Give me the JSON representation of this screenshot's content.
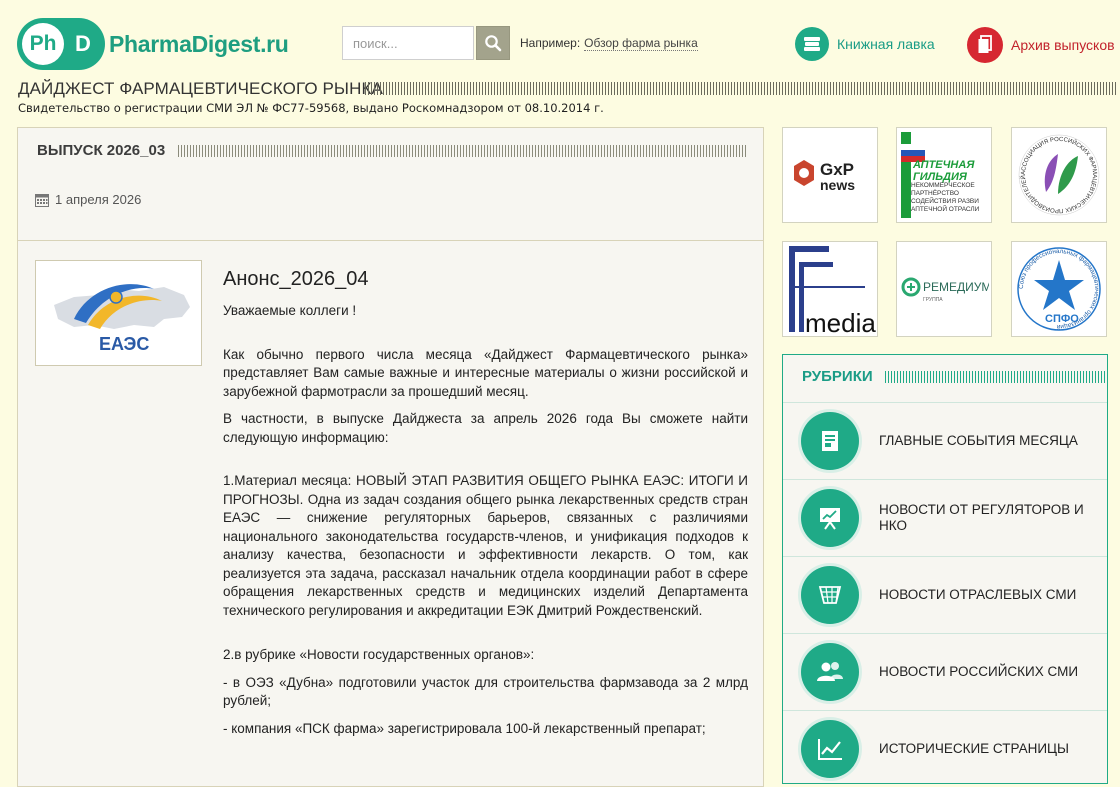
{
  "header": {
    "logo_badge_ph": "Ph",
    "logo_badge_d": "D",
    "logo_text": "PharmaDigest.ru",
    "search_placeholder": "поиск...",
    "example_label": "Например:",
    "example_link": "Обзор фарма рынка",
    "book_shop": "Книжная лавка",
    "archive": "Архив выпусков",
    "page_title": "ДАЙДЖЕСТ ФАРМАЦЕВТИЧЕСКОГО РЫНКА",
    "registration": "Свидетельство о регистрации СМИ ЭЛ № ФС77-59568, выдано Роскомнадзором от 08.10.2014 г."
  },
  "issue": {
    "title": "ВЫПУСК 2026_03",
    "date": "1 апреля 2026"
  },
  "post": {
    "thumb_caption": "ЕАЭС",
    "title": "Анонс_2026_04",
    "greeting": "Уважаемые коллеги !",
    "p1": "Как обычно первого числа месяца «Дайджест Фармацевтического рынка» представляет Вам самые важные и интересные материалы о жизни российской и зарубежной фармотрасли за прошедший месяц.",
    "p2": "В частности, в выпуске Дайджеста за апрель 2026 года Вы сможете найти следующую информацию:",
    "p3": "1.Материал месяца: НОВЫЙ ЭТАП РАЗВИТИЯ ОБЩЕГО РЫНКА ЕАЭС: ИТОГИ И ПРОГНОЗЫ. Одна из задач создания общего рынка лекарственных средств стран ЕАЭС — снижение регуляторных барьеров, связанных с различиями национального законодательства государств-членов, и унификация подходов к анализу качества, безопасности и эффективности лекарств. О том, как реализуется эта задача, рассказал начальник отдела координации работ в сфере обращения лекарственных средств и медицинских изделий Департамента технического регулирования и аккредитации ЕЭК Дмитрий Рождественский.",
    "p4": "2.в рубрике «Новости государственных органов»:",
    "p5": "- в ОЭЗ «Дубна» подготовили участок для строительства фармзавода за 2 млрд рублей;",
    "p6": "- компания «ПСК фарма» зарегистрировала 100-й лекарственный препарат;"
  },
  "partners": {
    "gxp_top": "GxP",
    "gxp_bottom": "news",
    "guild_top": "АПТЕЧНАЯ",
    "guild_mid": "ГИЛЬДИЯ",
    "guild_sub": "НЕКОММЕРЧЕСКОЕ ПАРТНЁРСТВО СОДЕЙСТВИЯ РАЗВИ АПТЕЧНОЙ ОТРАСЛИ",
    "assoc_text": "АССОЦИАЦИЯ РОССИЙСКИХ ФАРМАЦЕВТИЧЕСКИХ ПРОИЗВОДИТЕЛЕЙ",
    "fmedia": "media",
    "remedium": "РЕМЕДИУМ",
    "remedium_sub": "ГРУППА",
    "spfo_ring": "Союз профессиональных фармацевтических организаций",
    "spfo": "СПФО"
  },
  "rubrics": {
    "title": "РУБРИКИ",
    "items": [
      {
        "label": "ГЛАВНЫЕ СОБЫТИЯ МЕСЯЦА"
      },
      {
        "label": "НОВОСТИ ОТ РЕГУЛЯТОРОВ И НКО"
      },
      {
        "label": "НОВОСТИ ОТРАСЛЕВЫХ СМИ"
      },
      {
        "label": "НОВОСТИ РОССИЙСКИХ СМИ"
      },
      {
        "label": "ИСТОРИЧЕСКИЕ СТРАНИЦЫ"
      }
    ]
  },
  "colors": {
    "brand_green": "#1faa87",
    "archive_red": "#d62731",
    "background": "#fdfce1"
  }
}
